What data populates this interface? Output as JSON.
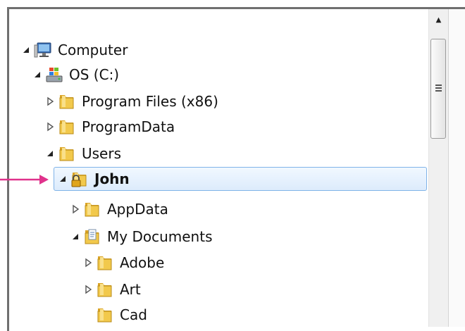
{
  "tree": {
    "items": [
      {
        "label": "Computer",
        "icon": "computer-icon",
        "state": "expanded"
      },
      {
        "label": "OS (C:)",
        "icon": "drive-icon",
        "state": "expanded"
      },
      {
        "label": "Program Files (x86)",
        "icon": "folder-icon",
        "state": "collapsed"
      },
      {
        "label": "ProgramData",
        "icon": "folder-icon",
        "state": "collapsed"
      },
      {
        "label": "Users",
        "icon": "folder-icon",
        "state": "expanded"
      },
      {
        "label": "John",
        "icon": "locked-folder-icon",
        "state": "expanded",
        "selected": true
      },
      {
        "label": "AppData",
        "icon": "folder-icon",
        "state": "collapsed"
      },
      {
        "label": "My Documents",
        "icon": "documents-folder-icon",
        "state": "expanded"
      },
      {
        "label": "Adobe",
        "icon": "folder-icon",
        "state": "collapsed"
      },
      {
        "label": "Art",
        "icon": "folder-icon",
        "state": "collapsed"
      },
      {
        "label": "Cad",
        "icon": "folder-icon",
        "state": "none"
      }
    ]
  },
  "annotation": {
    "icon": "pointer-arrow-icon",
    "color": "#e0328c"
  },
  "colors": {
    "selection_border": "#7fb3e8",
    "folder": "#e8b83a"
  }
}
